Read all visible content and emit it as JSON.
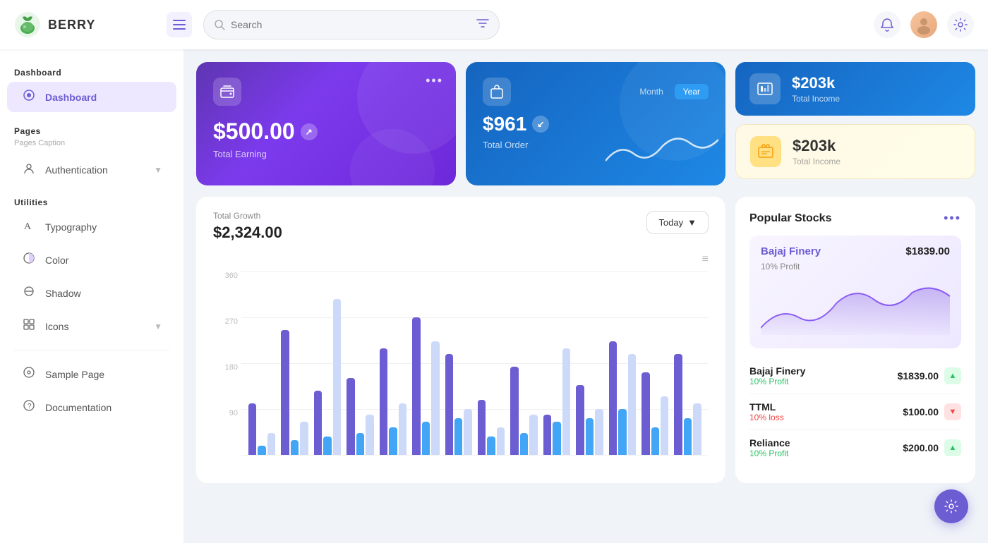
{
  "app": {
    "name": "BERRY",
    "logo_emoji": "🍓"
  },
  "topbar": {
    "search_placeholder": "Search",
    "hamburger_label": "☰",
    "notification_icon": "🔔",
    "settings_icon": "⚙",
    "avatar_emoji": "👤"
  },
  "sidebar": {
    "dashboard_section": "Dashboard",
    "dashboard_item": "Dashboard",
    "pages_section": "Pages",
    "pages_caption": "Pages Caption",
    "authentication_item": "Authentication",
    "utilities_section": "Utilities",
    "typography_item": "Typography",
    "color_item": "Color",
    "shadow_item": "Shadow",
    "icons_item": "Icons",
    "sample_page_item": "Sample Page",
    "documentation_item": "Documentation"
  },
  "cards": {
    "earning": {
      "amount": "$500.00",
      "label": "Total Earning",
      "icon": "💳"
    },
    "order": {
      "amount": "$961",
      "label": "Total Order",
      "tab_month": "Month",
      "tab_year": "Year",
      "icon": "🛍"
    },
    "income_blue": {
      "amount": "$203k",
      "label": "Total Income",
      "icon": "📊"
    },
    "income_yellow": {
      "amount": "$203k",
      "label": "Total Income",
      "icon": "🏷"
    }
  },
  "chart": {
    "title": "Total Growth",
    "total": "$2,324.00",
    "filter_btn": "Today",
    "y_labels": [
      "360",
      "270",
      "180",
      "90",
      ""
    ],
    "bars": [
      {
        "purple": 0.28,
        "blue": 0.05,
        "light": 0.12
      },
      {
        "purple": 0.68,
        "blue": 0.08,
        "light": 0.18
      },
      {
        "purple": 0.35,
        "blue": 0.1,
        "light": 0.85
      },
      {
        "purple": 0.42,
        "blue": 0.12,
        "light": 0.22
      },
      {
        "purple": 0.58,
        "blue": 0.15,
        "light": 0.28
      },
      {
        "purple": 0.75,
        "blue": 0.18,
        "light": 0.62
      },
      {
        "purple": 0.55,
        "blue": 0.2,
        "light": 0.25
      },
      {
        "purple": 0.3,
        "blue": 0.1,
        "light": 0.15
      },
      {
        "purple": 0.48,
        "blue": 0.12,
        "light": 0.22
      },
      {
        "purple": 0.22,
        "blue": 0.18,
        "light": 0.58
      },
      {
        "purple": 0.38,
        "blue": 0.2,
        "light": 0.25
      },
      {
        "purple": 0.62,
        "blue": 0.25,
        "light": 0.55
      },
      {
        "purple": 0.45,
        "blue": 0.15,
        "light": 0.32
      },
      {
        "purple": 0.55,
        "blue": 0.2,
        "light": 0.28
      }
    ]
  },
  "stocks": {
    "title": "Popular Stocks",
    "featured": {
      "name": "Bajaj Finery",
      "price": "$1839.00",
      "profit": "10% Profit"
    },
    "list": [
      {
        "name": "Bajaj Finery",
        "profit": "10% Profit",
        "profit_type": "green",
        "price": "$1839.00",
        "trend": "up"
      },
      {
        "name": "TTML",
        "profit": "10% loss",
        "profit_type": "red",
        "price": "$100.00",
        "trend": "down"
      },
      {
        "name": "Reliance",
        "profit": "10% Profit",
        "profit_type": "green",
        "price": "$200.00",
        "trend": "up"
      }
    ]
  },
  "fab": {
    "icon": "⚙"
  }
}
